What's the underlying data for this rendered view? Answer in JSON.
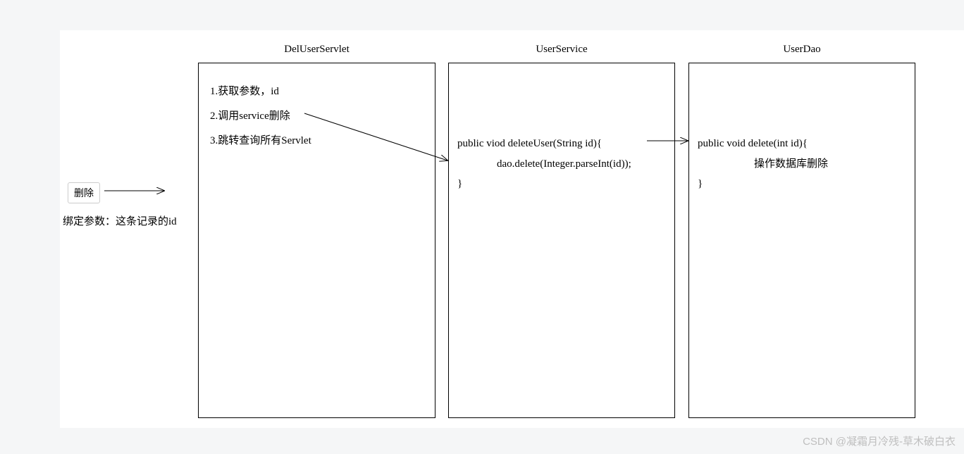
{
  "button": {
    "label": "删除"
  },
  "bind_label": "绑定参数：这条记录的id",
  "servlet": {
    "title": "DelUserServlet",
    "step1": "1.获取参数，id",
    "step2": "2.调用service删除",
    "step3": "3.跳转查询所有Servlet"
  },
  "service": {
    "title": "UserService",
    "line1": "public viod deleteUser(String id){",
    "line2": "dao.delete(Integer.parseInt(id));",
    "line3": "}"
  },
  "dao": {
    "title": "UserDao",
    "line1": "public void delete(int id){",
    "line2": "操作数据库删除",
    "line3": "}"
  },
  "watermark": "CSDN @凝霜月冷残-草木破白衣"
}
